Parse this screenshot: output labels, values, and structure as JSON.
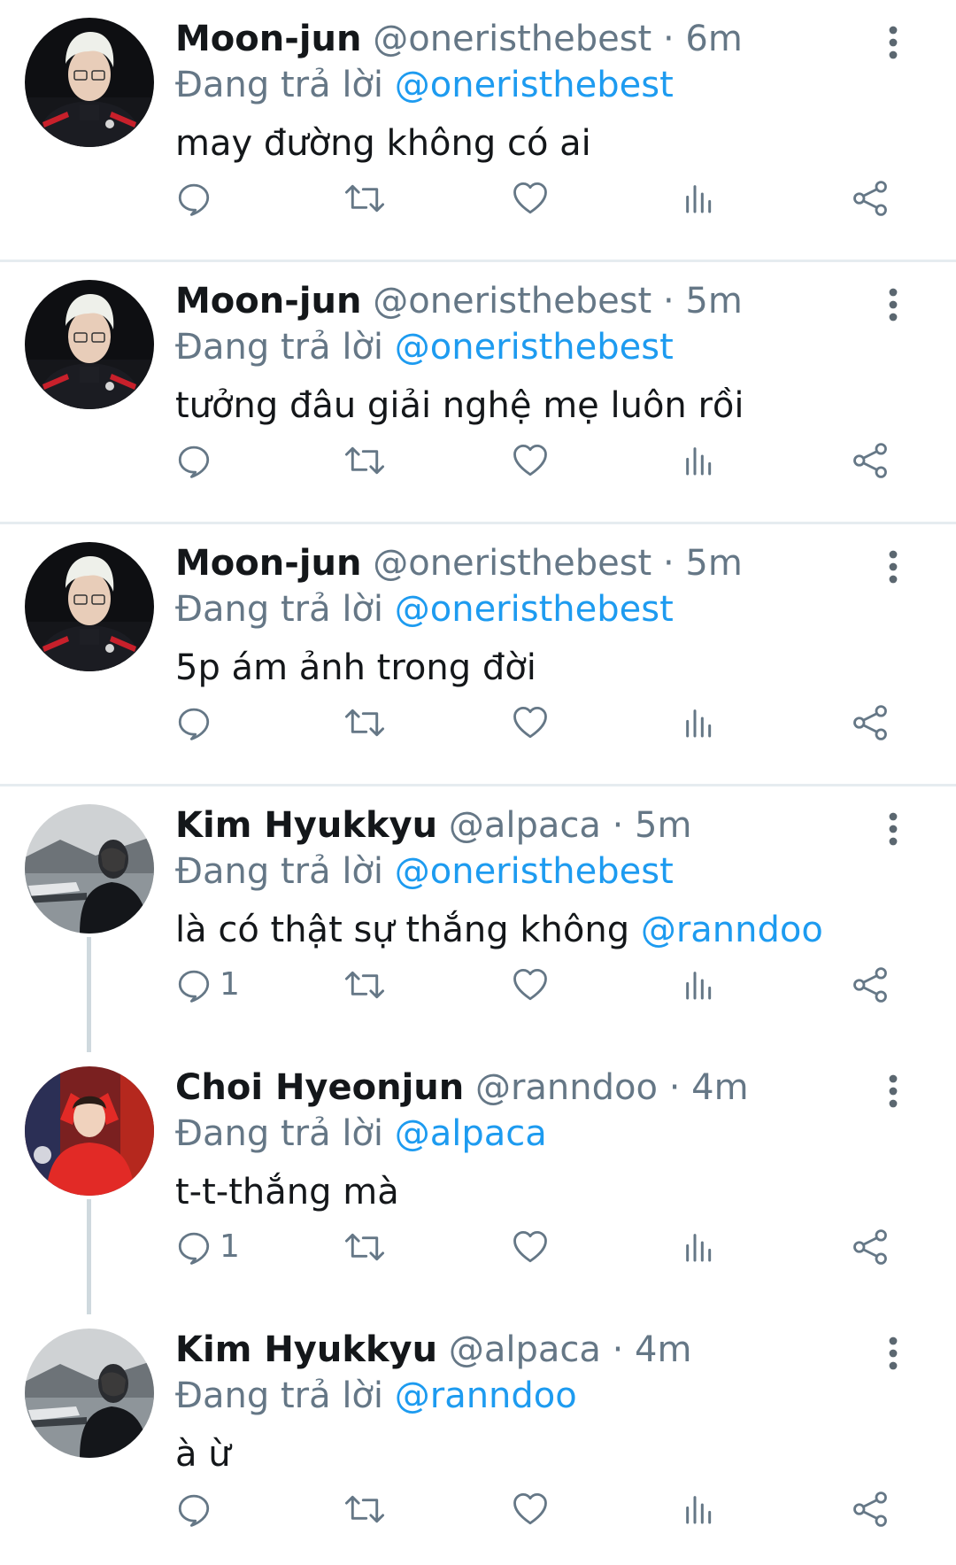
{
  "colors": {
    "accent": "#1d9bf0",
    "secondary_text": "#657786",
    "divider": "#e6ecf0",
    "thread_line": "#cfd9de"
  },
  "icons": {
    "reply": "reply-icon",
    "retweet": "retweet-icon",
    "like": "heart-icon",
    "views": "bar-chart-icon",
    "share": "share-icon",
    "more": "more-vertical-icon"
  },
  "tweets": [
    {
      "display_name": "Moon-jun",
      "handle": "@oneristhebest",
      "separator": "·",
      "time": "6m",
      "reply_prefix": "Đang trả lời",
      "reply_to": "@oneristhebest",
      "text": "may đường không có ai",
      "mention": "",
      "reply_count": ""
    },
    {
      "display_name": "Moon-jun",
      "handle": "@oneristhebest",
      "separator": "·",
      "time": "5m",
      "reply_prefix": "Đang trả lời",
      "reply_to": "@oneristhebest",
      "text": "tưởng đâu giải nghệ mẹ luôn rồi",
      "mention": "",
      "reply_count": ""
    },
    {
      "display_name": "Moon-jun",
      "handle": "@oneristhebest",
      "separator": "·",
      "time": "5m",
      "reply_prefix": "Đang trả lời",
      "reply_to": "@oneristhebest",
      "text": "5p ám ảnh trong đời",
      "mention": "",
      "reply_count": ""
    },
    {
      "display_name": "Kim Hyukkyu",
      "handle": "@alpaca",
      "separator": "·",
      "time": "5m",
      "reply_prefix": "Đang trả lời",
      "reply_to": "@oneristhebest",
      "text": "là có thật sự thắng không ",
      "mention": "@ranndoo",
      "reply_count": "1"
    },
    {
      "display_name": "Choi Hyeonjun",
      "handle": "@ranndoo",
      "separator": "·",
      "time": "4m",
      "reply_prefix": "Đang trả lời",
      "reply_to": "@alpaca",
      "text": "t-t-thắng mà",
      "mention": "",
      "reply_count": "1"
    },
    {
      "display_name": "Kim Hyukkyu",
      "handle": "@alpaca",
      "separator": "·",
      "time": "4m",
      "reply_prefix": "Đang trả lời",
      "reply_to": "@ranndoo",
      "text": "à ừ",
      "mention": "",
      "reply_count": ""
    }
  ]
}
